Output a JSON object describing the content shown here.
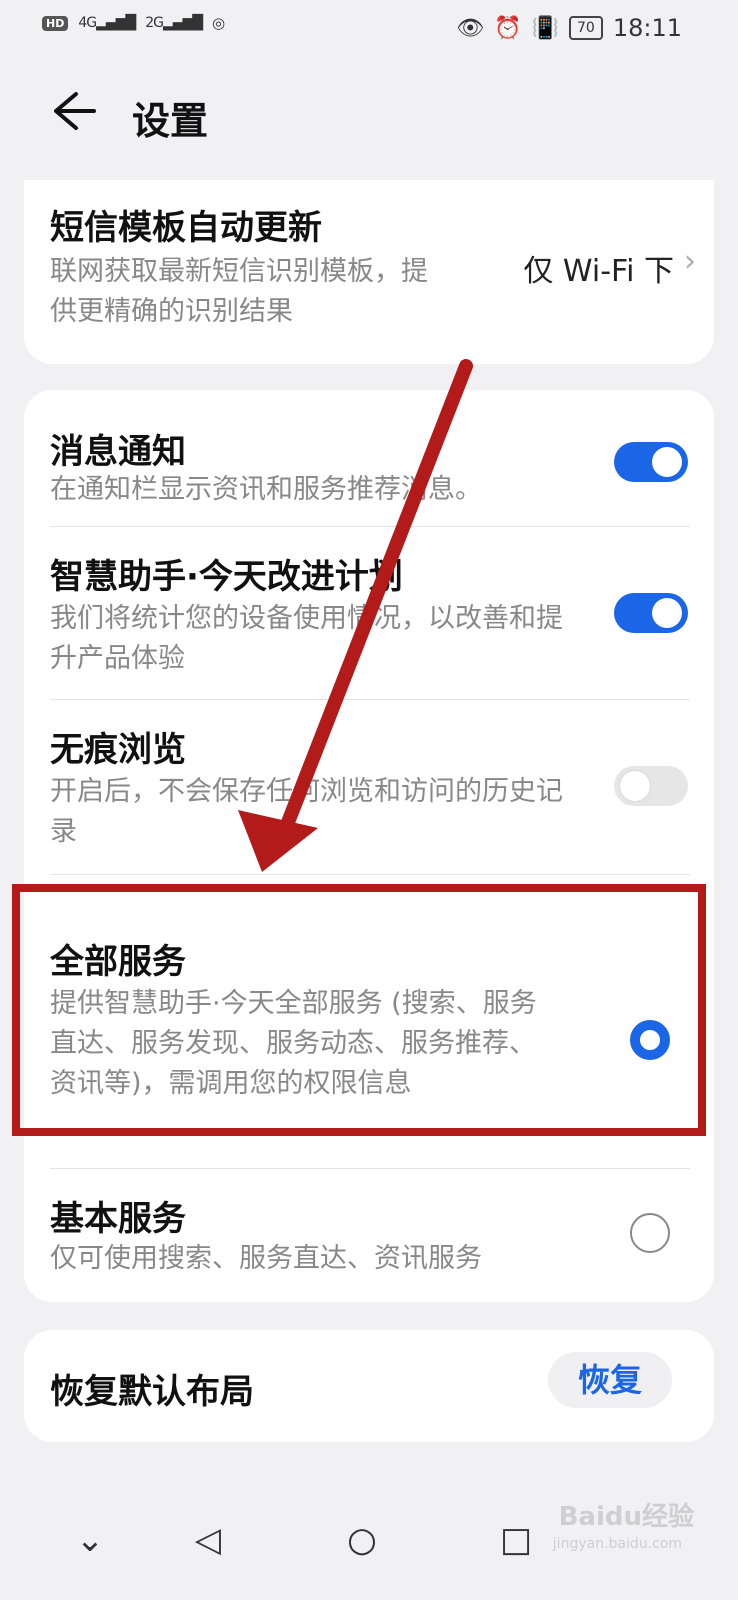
{
  "status_bar": {
    "hd": "HD",
    "net_1": "4G",
    "net_2": "2G",
    "battery": "70",
    "time": "18:11"
  },
  "header": {
    "title": "设置"
  },
  "sms_template": {
    "title": "短信模板自动更新",
    "subtitle": "联网获取最新短信识别模板，提供更精确的识别结果",
    "value": "仅 Wi-Fi 下"
  },
  "settings": [
    {
      "title": "消息通知",
      "subtitle": "在通知栏显示资讯和服务推荐消息。",
      "enabled": true
    },
    {
      "title": "智慧助手·今天改进计划",
      "subtitle": "我们将统计您的设备使用情况，以改善和提升产品体验",
      "enabled": true
    },
    {
      "title": "无痕浏览",
      "subtitle": "开启后，不会保存任何浏览和访问的历史记录",
      "enabled": false
    }
  ],
  "service_mode": {
    "selected": "全部服务",
    "options": [
      {
        "title": "全部服务",
        "subtitle": "提供智慧助手·今天全部服务 (搜索、服务直达、服务发现、服务动态、服务推荐、资讯等)，需调用您的权限信息"
      },
      {
        "title": "基本服务",
        "subtitle": "仅可使用搜索、服务直达、资讯服务"
      }
    ]
  },
  "restore": {
    "title": "恢复默认布局",
    "button": "恢复"
  },
  "watermark": {
    "text": "Baidu经验",
    "sub": "jingyan.baidu.com"
  },
  "colors": {
    "accent": "#1a66e6",
    "highlight": "#b31a1a",
    "background": "#f1f1f3"
  }
}
